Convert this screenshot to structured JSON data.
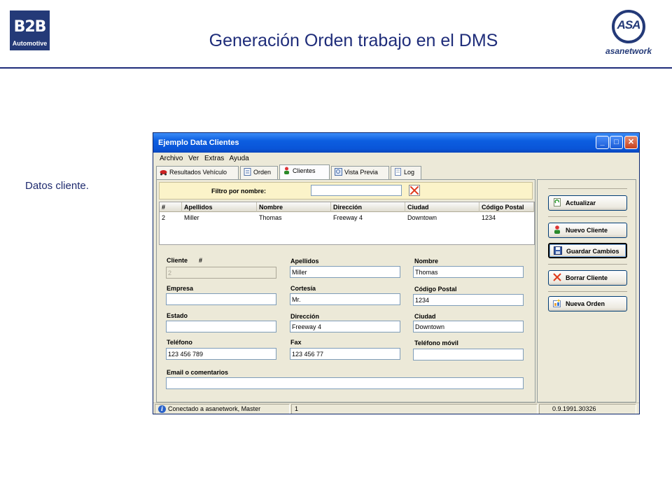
{
  "header": {
    "title": "Generación Orden trabajo en el DMS",
    "logo_left": {
      "line1": "B2B",
      "line2": "Automotive"
    },
    "logo_right": {
      "mark": "ASA",
      "name": "asanetwork"
    },
    "accent_color": "#1f2d7a"
  },
  "side_label": "Datos cliente.",
  "window": {
    "title": "Ejemplo Data Clientes",
    "controls": [
      "minimize-icon",
      "maximize-icon",
      "close-icon"
    ],
    "menu": [
      "Archivo",
      "Ver",
      "Extras",
      "Ayuda"
    ],
    "tabs": [
      {
        "label": "Resultados Vehículo",
        "icon": "car-icon"
      },
      {
        "label": "Orden",
        "icon": "order-icon"
      },
      {
        "label": "Clientes",
        "icon": "client-icon",
        "active": true
      },
      {
        "label": "Vista Previa",
        "icon": "preview-icon"
      },
      {
        "label": "Log",
        "icon": "log-icon"
      }
    ],
    "filter": {
      "label": "Filtro por nombre:",
      "value": ""
    },
    "grid": {
      "columns": [
        "#",
        "Apellidos",
        "Nombre",
        "Dirección",
        "Ciudad",
        "Código Postal"
      ],
      "rows": [
        [
          "2",
          "Miller",
          "Thomas",
          "Freeway 4",
          "Downtown",
          "1234"
        ]
      ]
    },
    "form": {
      "cliente": {
        "label": "Cliente",
        "hash": "#",
        "value": "2"
      },
      "apellidos": {
        "label": "Apellidos",
        "value": "Miller"
      },
      "nombre": {
        "label": "Nombre",
        "value": "Thomas"
      },
      "empresa": {
        "label": "Empresa",
        "value": ""
      },
      "cortesia": {
        "label": "Cortesía",
        "value": "Mr."
      },
      "codigo_postal": {
        "label": "Código Postal",
        "value": "1234"
      },
      "estado": {
        "label": "Estado",
        "value": ""
      },
      "direccion": {
        "label": "Dirección",
        "value": "Freeway 4"
      },
      "ciudad": {
        "label": "Ciudad",
        "value": "Downtown"
      },
      "telefono": {
        "label": "Teléfono",
        "value": "123 456 789"
      },
      "fax": {
        "label": "Fax",
        "value": "123 456 77"
      },
      "telefono_movil": {
        "label": "Teléfono móvil",
        "value": ""
      },
      "email": {
        "label": "Email o comentarios",
        "value": ""
      }
    },
    "actions": {
      "actualizar": "Actualizar",
      "nuevo_cliente": "Nuevo Cliente",
      "guardar_cambios": "Guardar Cambios",
      "borrar_cliente": "Borrar Cliente",
      "nueva_orden": "Nueva Orden"
    },
    "status": {
      "message": "Conectado a asanetwork, Master",
      "count": "1",
      "version": "0.9.1991.30326"
    }
  }
}
